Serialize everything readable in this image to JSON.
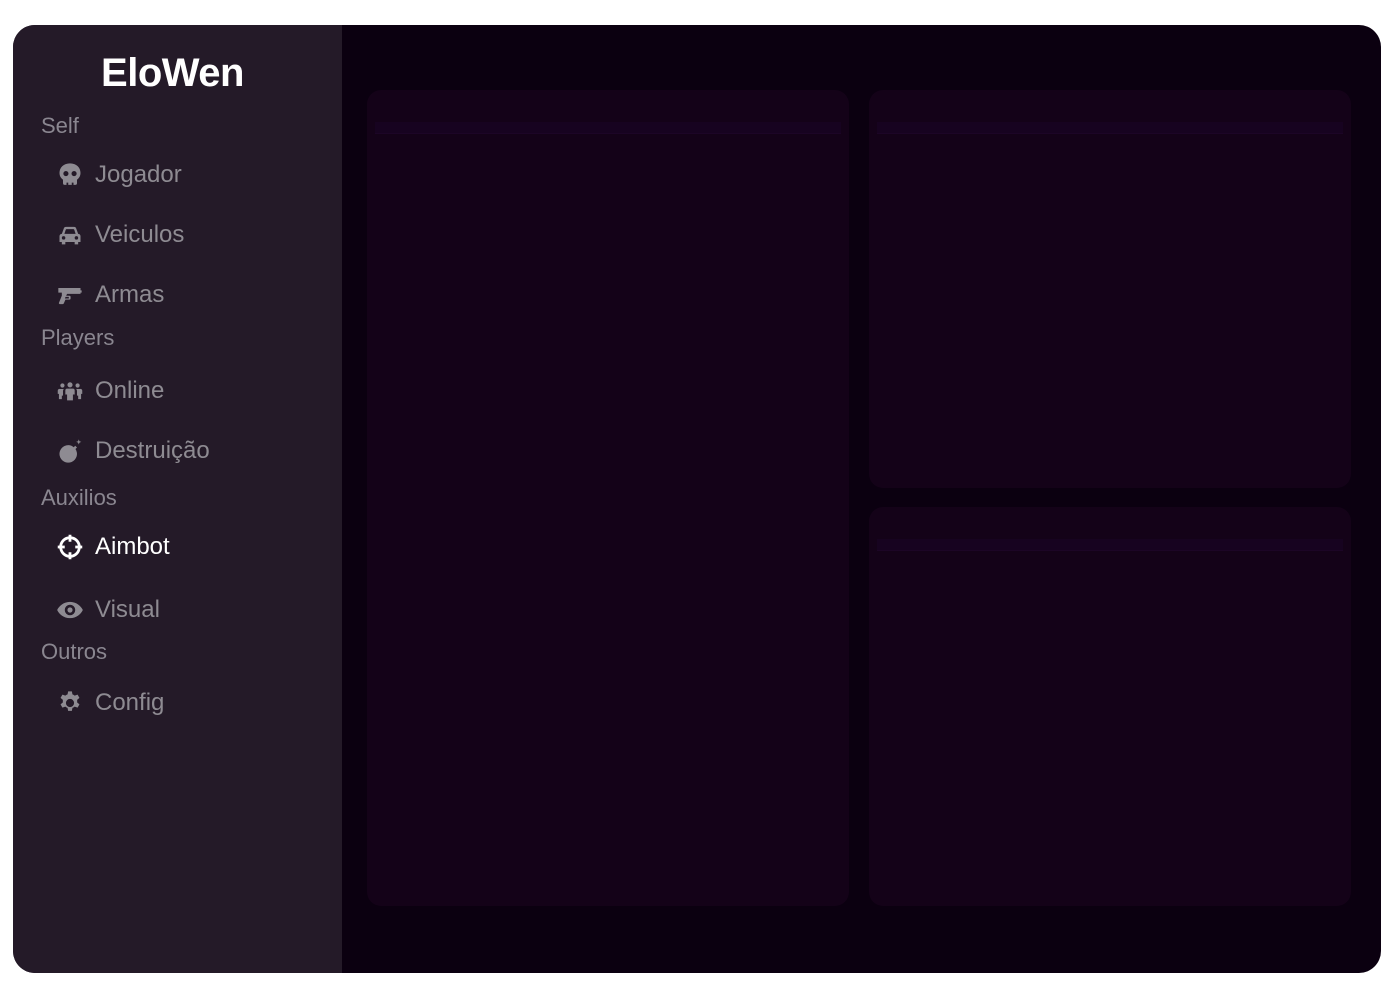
{
  "app": {
    "brand": "EloWen"
  },
  "sidebar": {
    "sections": [
      {
        "label": "Self"
      },
      {
        "label": "Players"
      },
      {
        "label": "Auxilios"
      },
      {
        "label": "Outros"
      }
    ],
    "items": [
      {
        "label": "Jogador",
        "icon": "skull-icon"
      },
      {
        "label": "Veiculos",
        "icon": "car-icon"
      },
      {
        "label": "Armas",
        "icon": "gun-icon"
      },
      {
        "label": "Online",
        "icon": "users-icon"
      },
      {
        "label": "Destruição",
        "icon": "bomb-icon"
      },
      {
        "label": "Aimbot",
        "icon": "crosshair-icon",
        "active": true
      },
      {
        "label": "Visual",
        "icon": "eye-icon"
      },
      {
        "label": "Config",
        "icon": "gear-icon"
      }
    ]
  },
  "colors": {
    "sidebar_bg": "#241a28",
    "main_bg": "#0b0010",
    "panel_bg": "#140218",
    "text_active": "#ffffff",
    "text_muted": "#8e8b92"
  }
}
